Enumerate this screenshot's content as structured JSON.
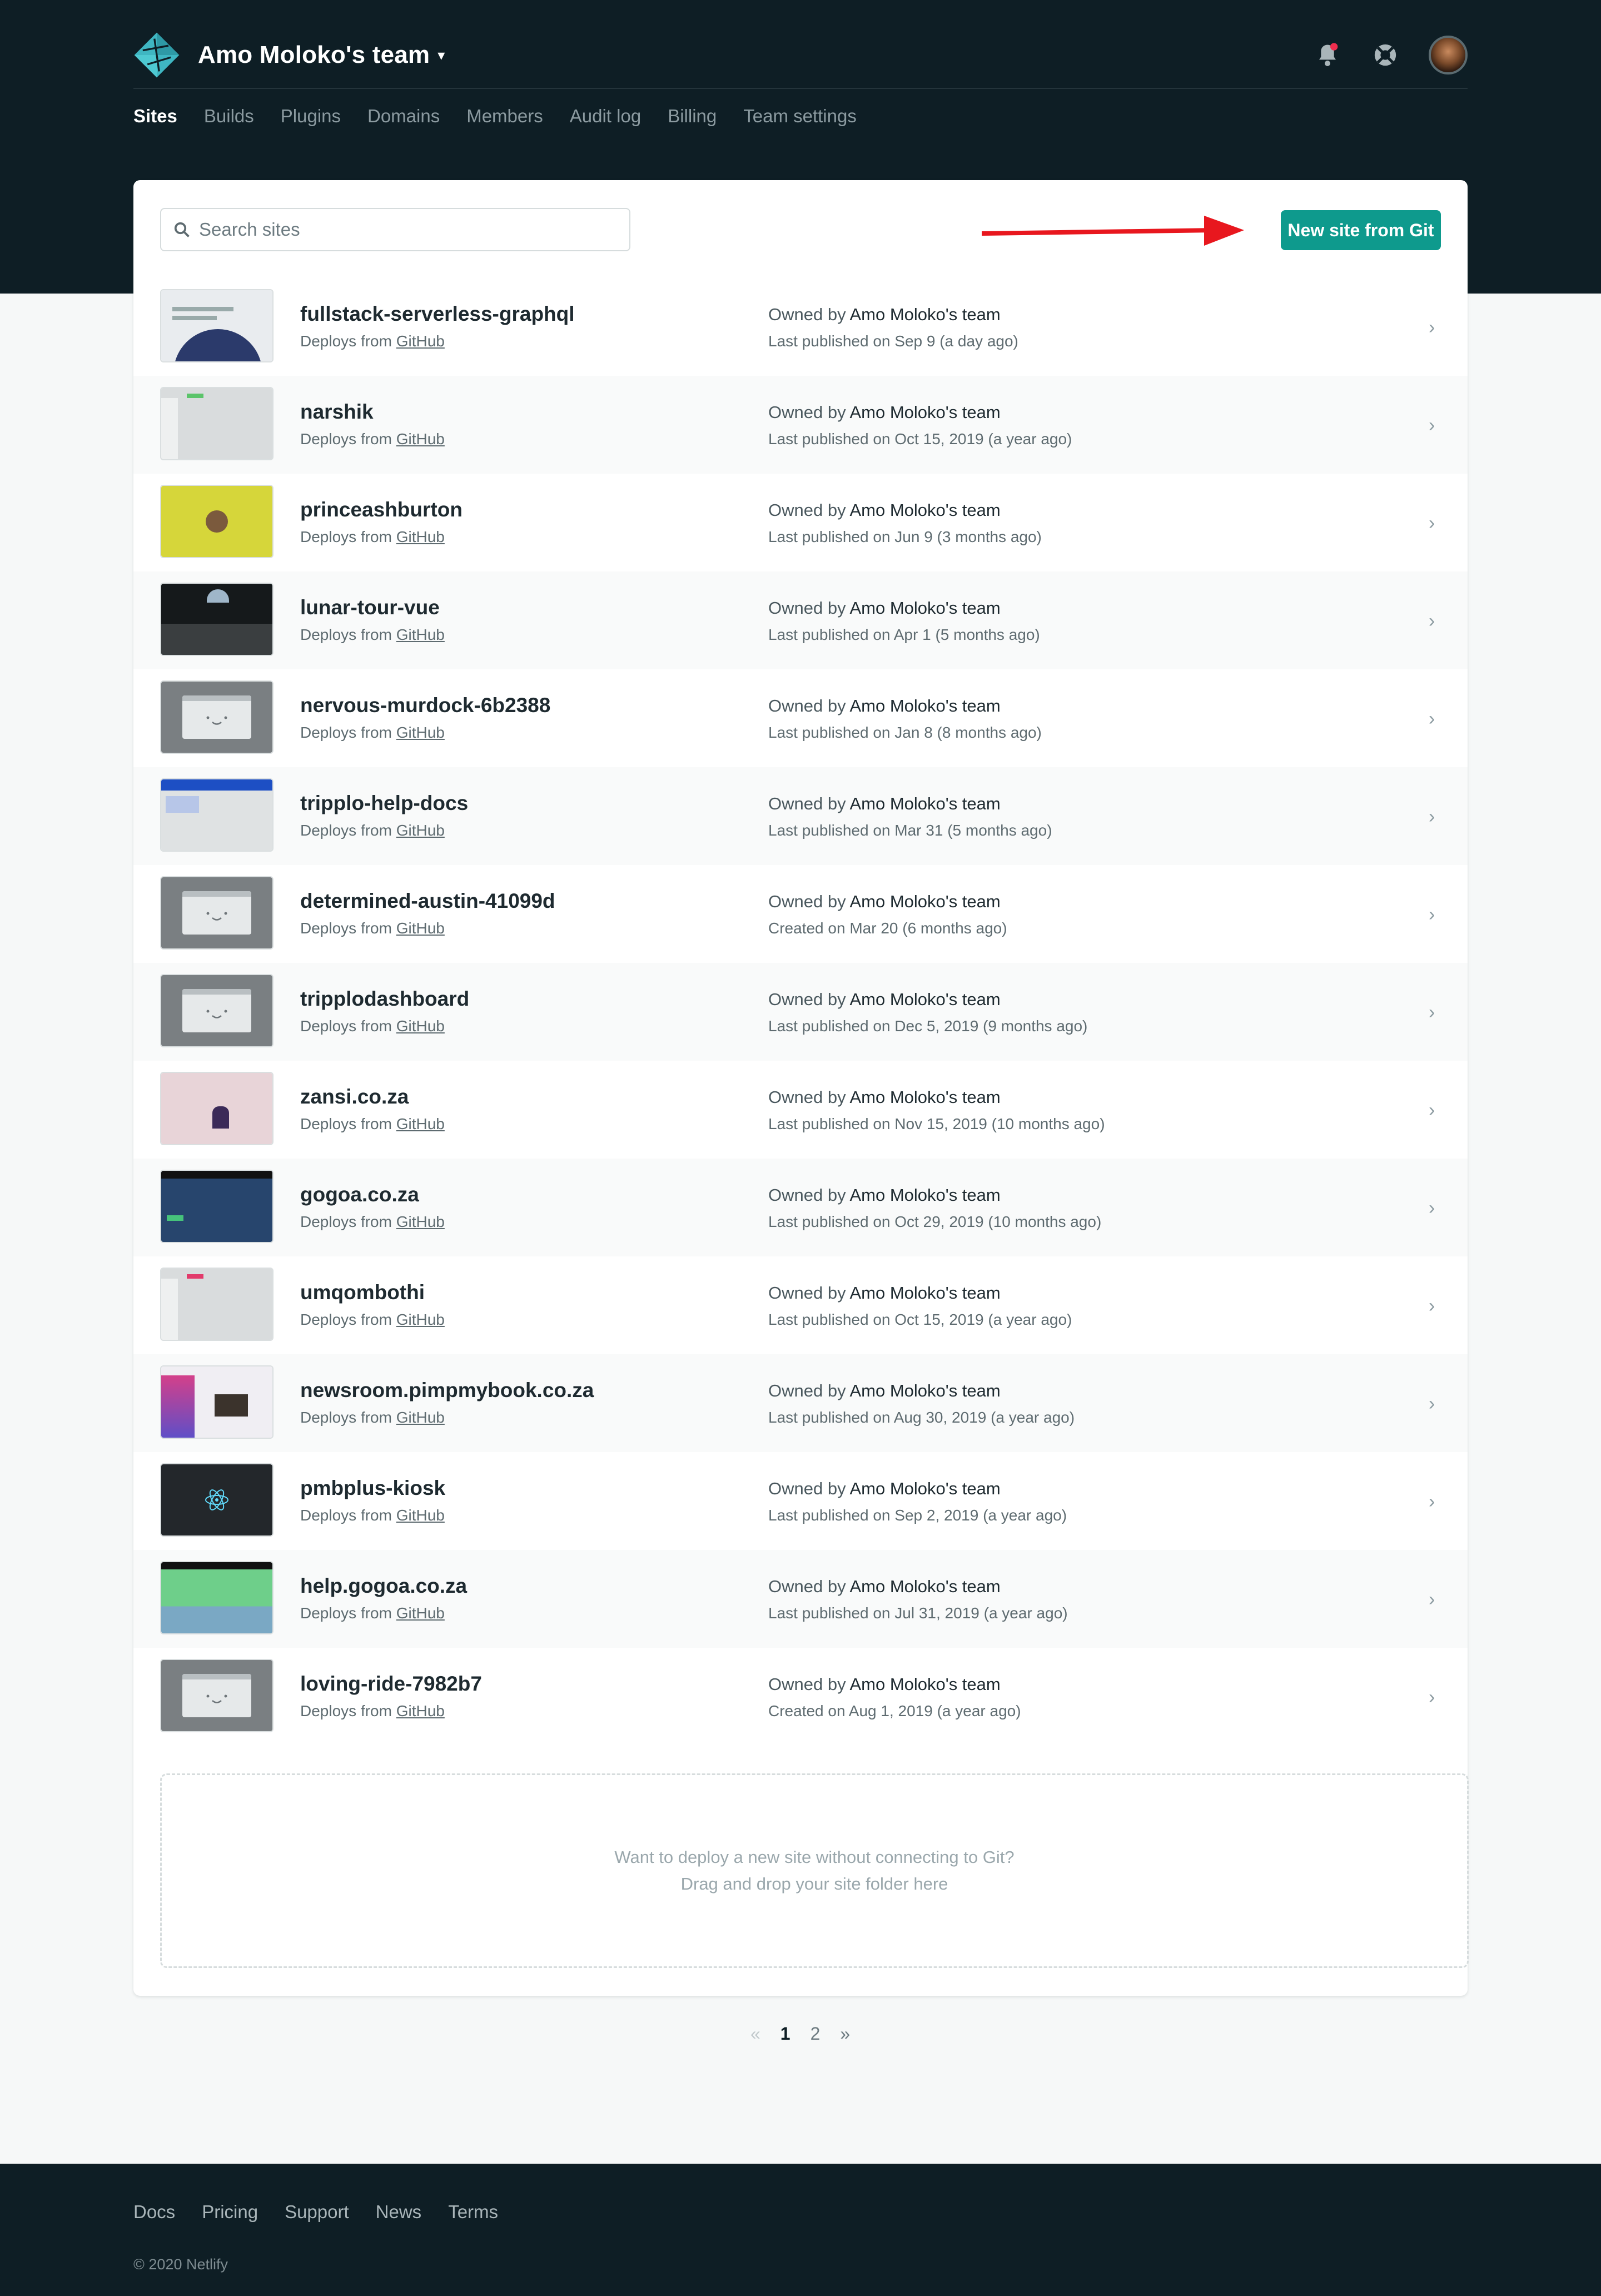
{
  "header": {
    "team_name": "Amo Moloko's team",
    "icons": [
      "netlify-logo-icon",
      "bell-icon",
      "lifebuoy-icon",
      "avatar"
    ],
    "notification_dot_color": "#f02e4e"
  },
  "nav": {
    "items": [
      "Sites",
      "Builds",
      "Plugins",
      "Domains",
      "Members",
      "Audit log",
      "Billing",
      "Team settings"
    ],
    "active": "Sites"
  },
  "search": {
    "placeholder": "Search sites",
    "value": ""
  },
  "new_site_button": "New site from Git",
  "deploys_prefix": "Deploys from",
  "deploys_provider": "GitHub",
  "owned_by_prefix": "Owned by",
  "sites": [
    {
      "name": "fullstack-serverless-graphql",
      "owner": "Amo Moloko's team",
      "published": "Last published on Sep 9 (a day ago)",
      "thumb": "graphql"
    },
    {
      "name": "narshik",
      "owner": "Amo Moloko's team",
      "published": "Last published on Oct 15, 2019 (a year ago)",
      "thumb": "grey-list"
    },
    {
      "name": "princeashburton",
      "owner": "Amo Moloko's team",
      "published": "Last published on Jun 9 (3 months ago)",
      "thumb": "yellow"
    },
    {
      "name": "lunar-tour-vue",
      "owner": "Amo Moloko's team",
      "published": "Last published on Apr 1 (5 months ago)",
      "thumb": "moon"
    },
    {
      "name": "nervous-murdock-6b2388",
      "owner": "Amo Moloko's team",
      "published": "Last published on Jan 8 (8 months ago)",
      "thumb": "face"
    },
    {
      "name": "tripplo-help-docs",
      "owner": "Amo Moloko's team",
      "published": "Last published on Mar 31 (5 months ago)",
      "thumb": "blue-docs"
    },
    {
      "name": "determined-austin-41099d",
      "owner": "Amo Moloko's team",
      "published": "Created on Mar 20 (6 months ago)",
      "thumb": "face"
    },
    {
      "name": "tripplodashboard",
      "owner": "Amo Moloko's team",
      "published": "Last published on Dec 5, 2019 (9 months ago)",
      "thumb": "face"
    },
    {
      "name": "zansi.co.za",
      "owner": "Amo Moloko's team",
      "published": "Last published on Nov 15, 2019 (10 months ago)",
      "thumb": "pink"
    },
    {
      "name": "gogoa.co.za",
      "owner": "Amo Moloko's team",
      "published": "Last published on Oct 29, 2019 (10 months ago)",
      "thumb": "navy"
    },
    {
      "name": "umqombothi",
      "owner": "Amo Moloko's team",
      "published": "Last published on Oct 15, 2019 (a year ago)",
      "thumb": "grey-list-pink"
    },
    {
      "name": "newsroom.pimpmybook.co.za",
      "owner": "Amo Moloko's team",
      "published": "Last published on Aug 30, 2019 (a year ago)",
      "thumb": "newsroom"
    },
    {
      "name": "pmbplus-kiosk",
      "owner": "Amo Moloko's team",
      "published": "Last published on Sep 2, 2019 (a year ago)",
      "thumb": "react"
    },
    {
      "name": "help.gogoa.co.za",
      "owner": "Amo Moloko's team",
      "published": "Last published on Jul 31, 2019 (a year ago)",
      "thumb": "green"
    },
    {
      "name": "loving-ride-7982b7",
      "owner": "Amo Moloko's team",
      "published": "Created on Aug 1, 2019 (a year ago)",
      "thumb": "face"
    }
  ],
  "dropzone": {
    "line1": "Want to deploy a new site without connecting to Git?",
    "line2": "Drag and drop your site folder here"
  },
  "pagination": {
    "prev": "«",
    "pages": [
      "1",
      "2"
    ],
    "current": "1",
    "next": "»"
  },
  "footer": {
    "links": [
      "Docs",
      "Pricing",
      "Support",
      "News",
      "Terms"
    ],
    "copyright": "© 2020 Netlify"
  },
  "colors": {
    "dark_bg": "#0e1e25",
    "accent_teal": "#0e9a8d",
    "arrow_red": "#e8171e"
  }
}
